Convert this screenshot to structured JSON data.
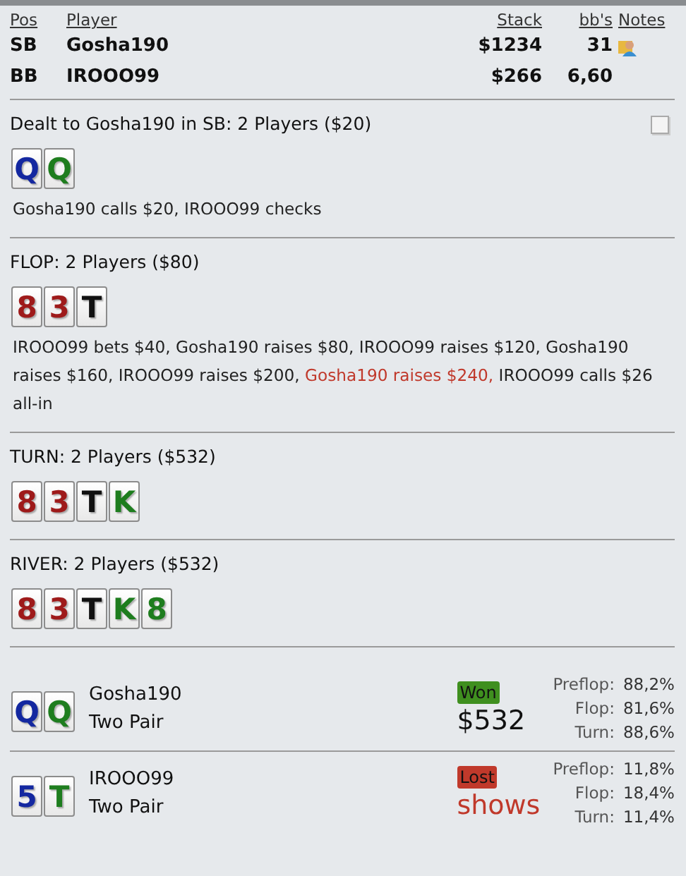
{
  "header": {
    "columns": [
      "Pos",
      "Player",
      "Stack",
      "bb's",
      "Notes"
    ]
  },
  "players": [
    {
      "pos": "SB",
      "name": "Gosha190",
      "stack": "$1234",
      "bbs": "31",
      "has_note": true
    },
    {
      "pos": "BB",
      "name": "IROOO99",
      "stack": "$266",
      "bbs": "6,60",
      "has_note": false
    }
  ],
  "streets": [
    {
      "title": "Dealt to Gosha190 in SB: 2 Players ($20)",
      "show_note_box": true,
      "cards": [
        {
          "rank": "Q",
          "color": "#1428a0"
        },
        {
          "rank": "Q",
          "color": "#1e7d1e"
        }
      ],
      "actions": [
        {
          "text": "Gosha190 calls $20, IROOO99 checks",
          "highlight": false
        }
      ]
    },
    {
      "title": "FLOP: 2 Players ($80)",
      "show_note_box": false,
      "cards": [
        {
          "rank": "8",
          "color": "#9e1a1a"
        },
        {
          "rank": "3",
          "color": "#9e1a1a"
        },
        {
          "rank": "T",
          "color": "#111111"
        }
      ],
      "actions": [
        {
          "text": "IROOO99 bets $40, Gosha190 raises $80, IROOO99 raises $120, Gosha190 raises $160, IROOO99 raises $200, ",
          "highlight": false
        },
        {
          "text": "Gosha190 raises $240,",
          "highlight": true
        },
        {
          "text": " IROOO99 calls $26 all-in",
          "highlight": false
        }
      ]
    },
    {
      "title": "TURN: 2 Players ($532)",
      "show_note_box": false,
      "cards": [
        {
          "rank": "8",
          "color": "#9e1a1a"
        },
        {
          "rank": "3",
          "color": "#9e1a1a"
        },
        {
          "rank": "T",
          "color": "#111111"
        },
        {
          "rank": "K",
          "color": "#1e7d1e"
        }
      ]
    },
    {
      "title": "RIVER: 2 Players ($532)",
      "show_note_box": false,
      "cards": [
        {
          "rank": "8",
          "color": "#9e1a1a"
        },
        {
          "rank": "3",
          "color": "#9e1a1a"
        },
        {
          "rank": "T",
          "color": "#111111"
        },
        {
          "rank": "K",
          "color": "#1e7d1e"
        },
        {
          "rank": "8",
          "color": "#1e7d1e"
        }
      ]
    }
  ],
  "results": [
    {
      "cards": [
        {
          "rank": "Q",
          "color": "#1428a0"
        },
        {
          "rank": "Q",
          "color": "#1e7d1e"
        }
      ],
      "name": "Gosha190",
      "hand": "Two Pair",
      "kind": "won",
      "badge": "Won",
      "amount": "$532",
      "equities": [
        {
          "label": "Preflop:",
          "value": "88,2%"
        },
        {
          "label": "Flop:",
          "value": "81,6%"
        },
        {
          "label": "Turn:",
          "value": "88,6%"
        }
      ]
    },
    {
      "cards": [
        {
          "rank": "5",
          "color": "#1428a0"
        },
        {
          "rank": "T",
          "color": "#1e7d1e"
        }
      ],
      "name": "IROOO99",
      "hand": "Two Pair",
      "kind": "lost",
      "badge": "Lost",
      "amount": "shows",
      "equities": [
        {
          "label": "Preflop:",
          "value": "11,8%"
        },
        {
          "label": "Flop:",
          "value": "18,4%"
        },
        {
          "label": "Turn:",
          "value": "11,4%"
        }
      ]
    }
  ]
}
